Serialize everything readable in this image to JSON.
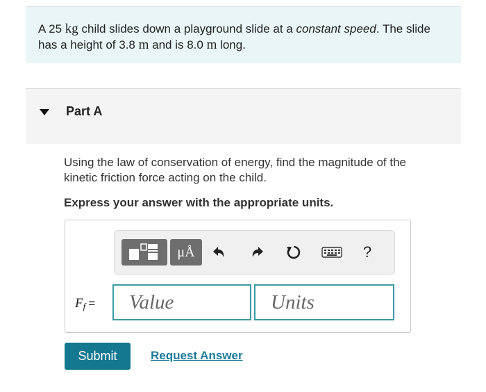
{
  "problem": {
    "p1": "A 25 ",
    "kg": "kg",
    "p2": " child slides down a playground slide at a ",
    "constant_speed": "constant speed",
    "p3": ". The slide has a height of 3.8 ",
    "m1": "m",
    "p4": " and is 8.0 ",
    "m2": "m",
    "p5": " long."
  },
  "part": {
    "title": "Part A"
  },
  "question": {
    "text": "Using the law of conservation of energy, find the magnitude of the kinetic friction force acting on the child.",
    "instruction": "Express your answer with the appropriate units."
  },
  "toolbar": {
    "units_label": "μÅ",
    "undo_icon": "undo-icon",
    "redo_icon": "redo-icon",
    "reset_icon": "reset-icon",
    "keyboard_icon": "keyboard-icon",
    "help_label": "?"
  },
  "answer": {
    "label_var": "F",
    "label_sub": "f",
    "label_eq": "=",
    "value_placeholder": "Value",
    "units_placeholder": "Units"
  },
  "actions": {
    "submit": "Submit",
    "request": "Request Answer"
  },
  "colors": {
    "accent": "#157891",
    "field_border": "#3b9aa4",
    "problem_bg": "#e9f5f6"
  }
}
